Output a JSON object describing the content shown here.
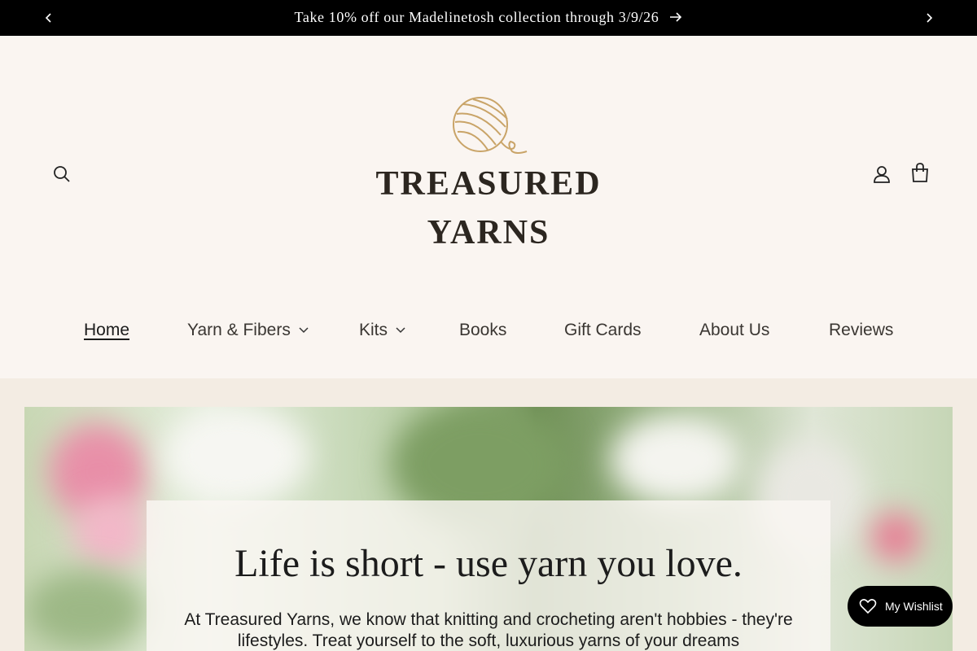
{
  "announcement": {
    "text": "Take 10% off our Madelinetosh collection through 3/9/26"
  },
  "logo": {
    "line1": "TREASURED",
    "line2": "YARNS"
  },
  "nav": {
    "items": [
      {
        "label": "Home",
        "active": true,
        "has_dropdown": false
      },
      {
        "label": "Yarn & Fibers",
        "active": false,
        "has_dropdown": true
      },
      {
        "label": "Kits",
        "active": false,
        "has_dropdown": true
      },
      {
        "label": "Books",
        "active": false,
        "has_dropdown": false
      },
      {
        "label": "Gift Cards",
        "active": false,
        "has_dropdown": false
      },
      {
        "label": "About Us",
        "active": false,
        "has_dropdown": false
      },
      {
        "label": "Reviews",
        "active": false,
        "has_dropdown": false
      }
    ]
  },
  "hero": {
    "title": "Life is short - use yarn you love.",
    "body": "At Treasured Yarns, we know that knitting and crocheting aren't hobbies - they're lifestyles. Treat yourself to the soft, luxurious yarns of your dreams"
  },
  "wishlist": {
    "label": "My Wishlist"
  },
  "icons": {
    "search": "search-icon",
    "account": "account-icon",
    "cart": "cart-icon",
    "prev": "chevron-left-icon",
    "next": "chevron-right-icon",
    "arrow": "arrow-right-icon",
    "heart": "heart-icon",
    "logo": "yarn-ball-icon"
  },
  "colors": {
    "announcement_bg": "#000000",
    "header_bg": "#faf5f1",
    "page_bg": "#f3ece3",
    "logo_gold": "#c9a468"
  }
}
